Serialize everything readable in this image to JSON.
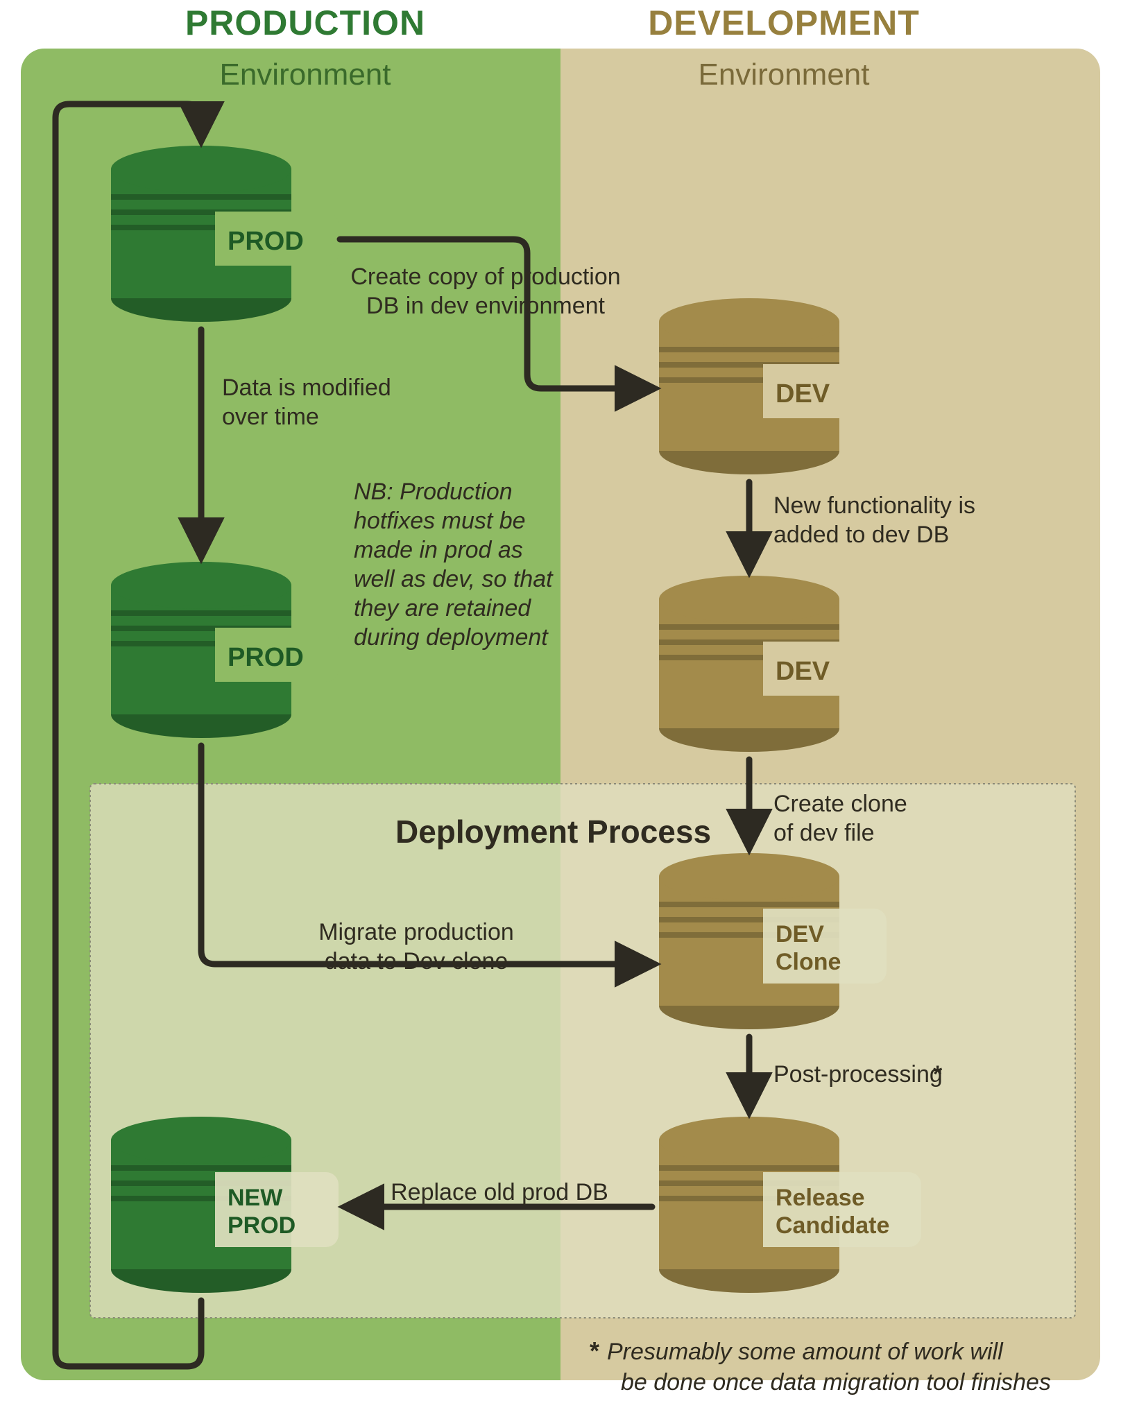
{
  "colors": {
    "prodHeader": "#2f7a33",
    "devHeader": "#97803e",
    "prodBg": "#8fbb64",
    "devBg": "#d6caa0",
    "deployBg": "#e0dfbf",
    "deployBorder": "#8a8a78",
    "dbGreen": "#2f7a33",
    "dbGreenDark": "#235d27",
    "dbOlive": "#a38b4b",
    "dbOliveDark": "#7f6d3a",
    "arrow": "#2d2a22",
    "text": "#2f2b20",
    "textOlive": "#6f5c27",
    "textGreen": "#1e5a25"
  },
  "headers": {
    "prodTitle": "PRODUCTION",
    "prodSub": "Environment",
    "devTitle": "DEVELOPMENT",
    "devSub": "Environment"
  },
  "dbLabels": {
    "prod1": "PROD",
    "prod2": "PROD",
    "dev1": "DEV",
    "dev2": "DEV",
    "devClone1": "DEV",
    "devClone2": "Clone",
    "rc1": "Release",
    "rc2": "Candidate",
    "newProd1": "NEW",
    "newProd2": "PROD"
  },
  "edges": {
    "copyProd1": "Create copy of production",
    "copyProd2": "DB in dev environment",
    "dataMod1": "Data is modified",
    "dataMod2": "over time",
    "addFunc1": "New functionality is",
    "addFunc2": "added to dev DB",
    "cloneDev1": "Create clone",
    "cloneDev2": "of dev file",
    "migrate1": "Migrate production",
    "migrate2": "data to Dev clone",
    "postProc": "Post-processing",
    "replace": "Replace old prod DB"
  },
  "aside": {
    "nb1": "NB: Production",
    "nb2": "hotfixes must be",
    "nb3": "made in prod as",
    "nb4": "well as dev, so that",
    "nb5": "they are retained",
    "nb6": "during deployment"
  },
  "deployTitle": "Deployment Process",
  "footnote": {
    "star": "*",
    "line1": "Presumably some amount of work will",
    "line2": "be done once data migration tool finishes"
  }
}
